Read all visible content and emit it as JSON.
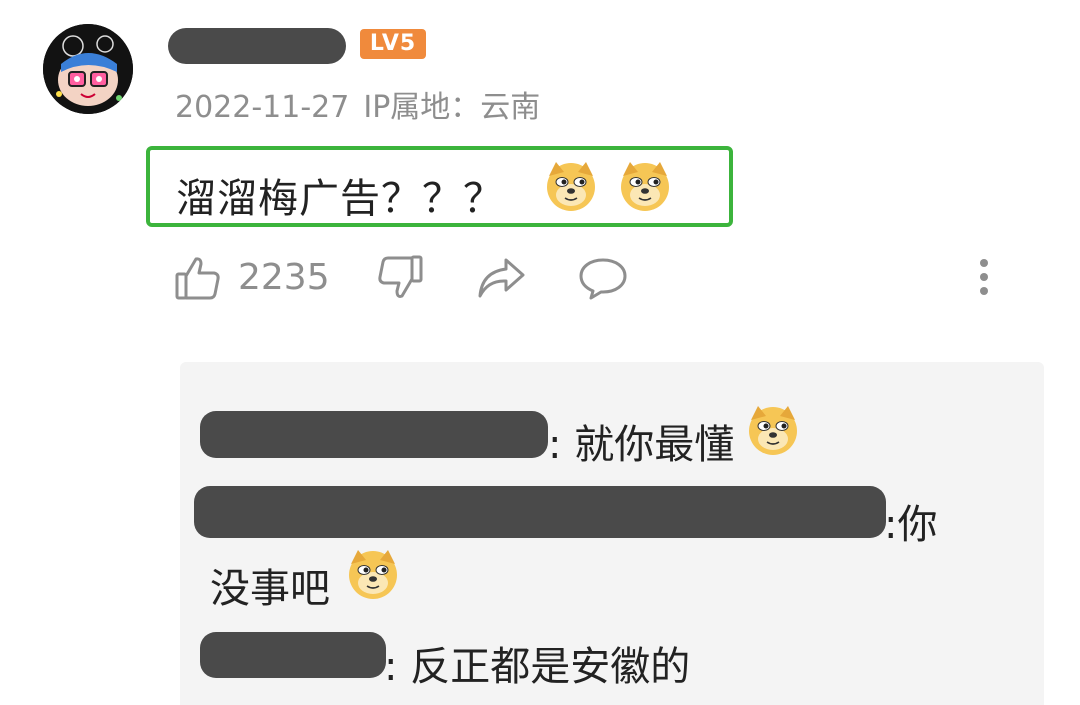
{
  "comment": {
    "level_badge": "LV5",
    "date": "2022-11-27",
    "ip_location": "IP属地：云南",
    "text": "溜溜梅广告？？？",
    "emojis": [
      "doge-emoji",
      "doge-emoji"
    ],
    "likes": "2235"
  },
  "actions": {
    "like_icon": "thumbs-up-icon",
    "dislike_icon": "thumbs-down-icon",
    "share_icon": "share-icon",
    "reply_icon": "comment-bubble-icon",
    "more_icon": "more-vertical-icon"
  },
  "replies": [
    {
      "text": ": 就你最懂",
      "emoji": "doge-emoji"
    },
    {
      "text": ":你",
      "text_line2": "没事吧",
      "emoji": "doge-emoji"
    },
    {
      "text": ": 反正都是安徽的"
    }
  ],
  "colors": {
    "highlight_border": "#3cb43c",
    "level_badge": "#f08a3c",
    "meta_text": "#8e8e8e",
    "reply_panel_bg": "#f4f4f4"
  }
}
